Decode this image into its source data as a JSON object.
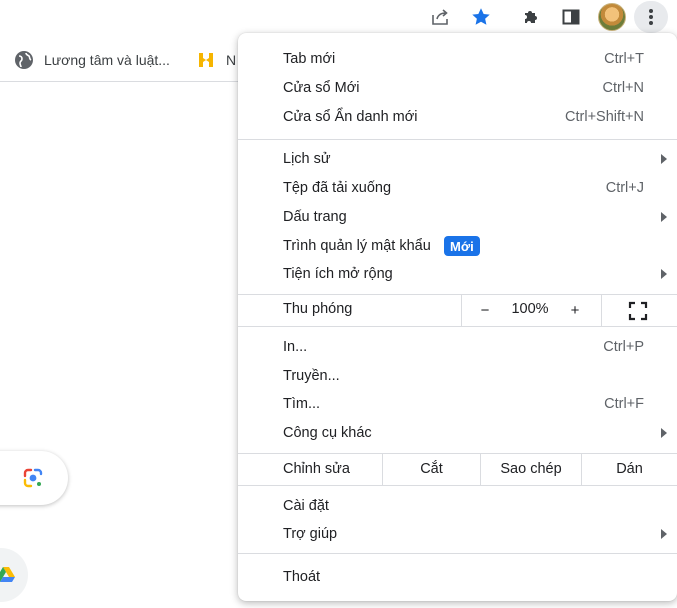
{
  "toolbar": {
    "icons": [
      "share-icon",
      "star-icon",
      "extensions-icon",
      "side-panel-icon",
      "avatar",
      "kebab-menu-icon"
    ],
    "accent": "#1a73e8"
  },
  "bookmarks": {
    "items": [
      {
        "label": "Lương tâm và luật...",
        "icon": "globe-icon"
      },
      {
        "label": "N",
        "icon": "yellow-logo-icon"
      }
    ]
  },
  "menu": {
    "items": [
      {
        "label": "Tab mới",
        "shortcut": "Ctrl+T"
      },
      {
        "label": "Cửa sổ Mới",
        "shortcut": "Ctrl+N"
      },
      {
        "label": "Cửa sổ Ẩn danh mới",
        "shortcut": "Ctrl+Shift+N"
      },
      {
        "label": "Lịch sử",
        "submenu": true
      },
      {
        "label": "Tệp đã tải xuống",
        "shortcut": "Ctrl+J"
      },
      {
        "label": "Dấu trang",
        "submenu": true
      },
      {
        "label": "Trình quản lý mật khẩu",
        "badge": "Mới"
      },
      {
        "label": "Tiện ích mở rộng",
        "submenu": true
      },
      {
        "label": "In...",
        "shortcut": "Ctrl+P"
      },
      {
        "label": "Truyền..."
      },
      {
        "label": "Tìm...",
        "shortcut": "Ctrl+F"
      },
      {
        "label": "Công cụ khác",
        "submenu": true
      },
      {
        "label": "Cài đặt"
      },
      {
        "label": "Trợ giúp",
        "submenu": true
      },
      {
        "label": "Thoát"
      }
    ],
    "zoom": {
      "label": "Thu phóng",
      "minus": "−",
      "value": "100%",
      "plus": "+"
    },
    "edit": {
      "label": "Chỉnh sửa",
      "cut": "Cắt",
      "copy": "Sao chép",
      "paste": "Dán"
    }
  }
}
